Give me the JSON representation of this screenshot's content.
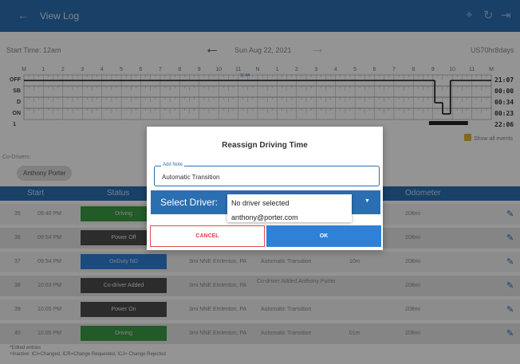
{
  "app_bar": {
    "back_icon": "arrow-left-icon",
    "title": "View Log",
    "icons": [
      "wifi-signal-icon",
      "refresh-icon",
      "logout-icon"
    ]
  },
  "date_bar": {
    "start_time": "Start Time: 12am",
    "date": "Sun Aug 22, 2021",
    "ruleset": "US70hr8days"
  },
  "graph": {
    "hour_labels": [
      "M",
      "1",
      "2",
      "3",
      "4",
      "5",
      "6",
      "7",
      "8",
      "9",
      "10",
      "11",
      "N",
      "1",
      "2",
      "3",
      "4",
      "5",
      "6",
      "7",
      "8",
      "9",
      "10",
      "11",
      "M"
    ],
    "status_rows": [
      "OFF",
      "SB",
      "D",
      "ON"
    ],
    "row_totals": [
      "21:07",
      "00:00",
      "00:34",
      "00:23"
    ],
    "day_total": "22:06",
    "edit_marker": "1",
    "active_period_label": "11:04"
  },
  "show_all_events": {
    "label": "Show all events",
    "checked": true
  },
  "co_drivers": {
    "label": "Co-Drivers:",
    "chips": [
      "Anthony Porter"
    ]
  },
  "table": {
    "headers": [
      "Start",
      "Status",
      "Odometer"
    ],
    "rows": [
      {
        "num": "35",
        "time": "09:40 PM",
        "status": "Driving",
        "status_color": "#3b9b45",
        "location": "",
        "note": "",
        "duration": "",
        "odometer": "208mi"
      },
      {
        "num": "36",
        "time": "09:54 PM",
        "status": "Power Off",
        "status_color": "#4d4d4d",
        "location": "",
        "note": "",
        "duration": "",
        "odometer": "208mi"
      },
      {
        "num": "37",
        "time": "09:54 PM",
        "status": "OnDuty ND",
        "status_color": "#2f80d7",
        "location": "3mi NNE Emlenton, PA",
        "note": "Automatic Transition",
        "duration": "10m",
        "odometer": "208mi"
      },
      {
        "num": "38",
        "time": "10:03 PM",
        "status": "Co-driver Added",
        "status_color": "#4d4d4d",
        "location": "3mi NNE Emlenton, PA",
        "note": "Co-driver Added Anthony Porter",
        "duration": "",
        "odometer": "208mi"
      },
      {
        "num": "39",
        "time": "10:05 PM",
        "status": "Power On",
        "status_color": "#4d4d4d",
        "location": "3mi NNE Emlenton, PA",
        "note": "Automatic Transition",
        "duration": "",
        "odometer": "208mi"
      },
      {
        "num": "40",
        "time": "10:05 PM",
        "status": "Driving",
        "status_color": "#3b9b45",
        "location": "3mi NNE Emlenton, PA",
        "note": "Automatic Transition",
        "duration": "01m",
        "odometer": "208mi"
      }
    ]
  },
  "footnote": {
    "line1": "*Edited entries",
    "line2": "+Inactive: ICI=Changed, ICR=Change Requested, ICJ= Change Rejected"
  },
  "dialog": {
    "title": "Reassign Driving Time",
    "note_label": "Add Note",
    "note_value": "Automatic Transition",
    "select_label": "Select Driver:",
    "options": [
      "No driver selected",
      "anthony@porter.com"
    ],
    "cancel": "CANCEL",
    "ok": "OK"
  }
}
